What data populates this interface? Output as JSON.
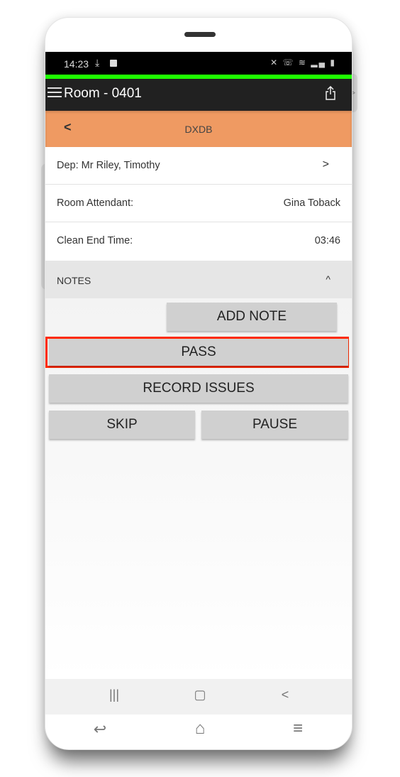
{
  "status_bar": {
    "time": "14:23",
    "left_icons": [
      "download-icon",
      "checkbox-notification-icon"
    ],
    "right_icons": [
      "mute-icon",
      "wifi-call-icon",
      "wifi-icon",
      "signal-icon",
      "battery-icon"
    ]
  },
  "app_bar": {
    "title": "Room - 0401",
    "menu_icon": "hamburger-menu-icon",
    "share_icon": "share-icon"
  },
  "sub_header": {
    "back": "<",
    "title": "DXDB"
  },
  "details": [
    {
      "label": "Dep: Mr Riley, Timothy",
      "value": ">"
    },
    {
      "label": "Room Attendant:",
      "value": "Gina Toback"
    },
    {
      "label": "Clean End Time:",
      "value": "03:46"
    }
  ],
  "notes": {
    "label": "NOTES",
    "toggle": "^"
  },
  "buttons": {
    "add_note": "ADD NOTE",
    "pass": "PASS",
    "record_issues": "RECORD ISSUES",
    "skip": "SKIP",
    "pause": "PAUSE"
  },
  "highlight_color": "#ff2a00",
  "accent_colors": {
    "status_green": "#1eff00",
    "header_orange": "#ef9a62"
  },
  "system_nav": {
    "recents": "|||",
    "home": "▢",
    "back": "<"
  },
  "system_nav2": {
    "back": "↩",
    "home": "⌂",
    "menu": "≡"
  },
  "side_tab": ">"
}
